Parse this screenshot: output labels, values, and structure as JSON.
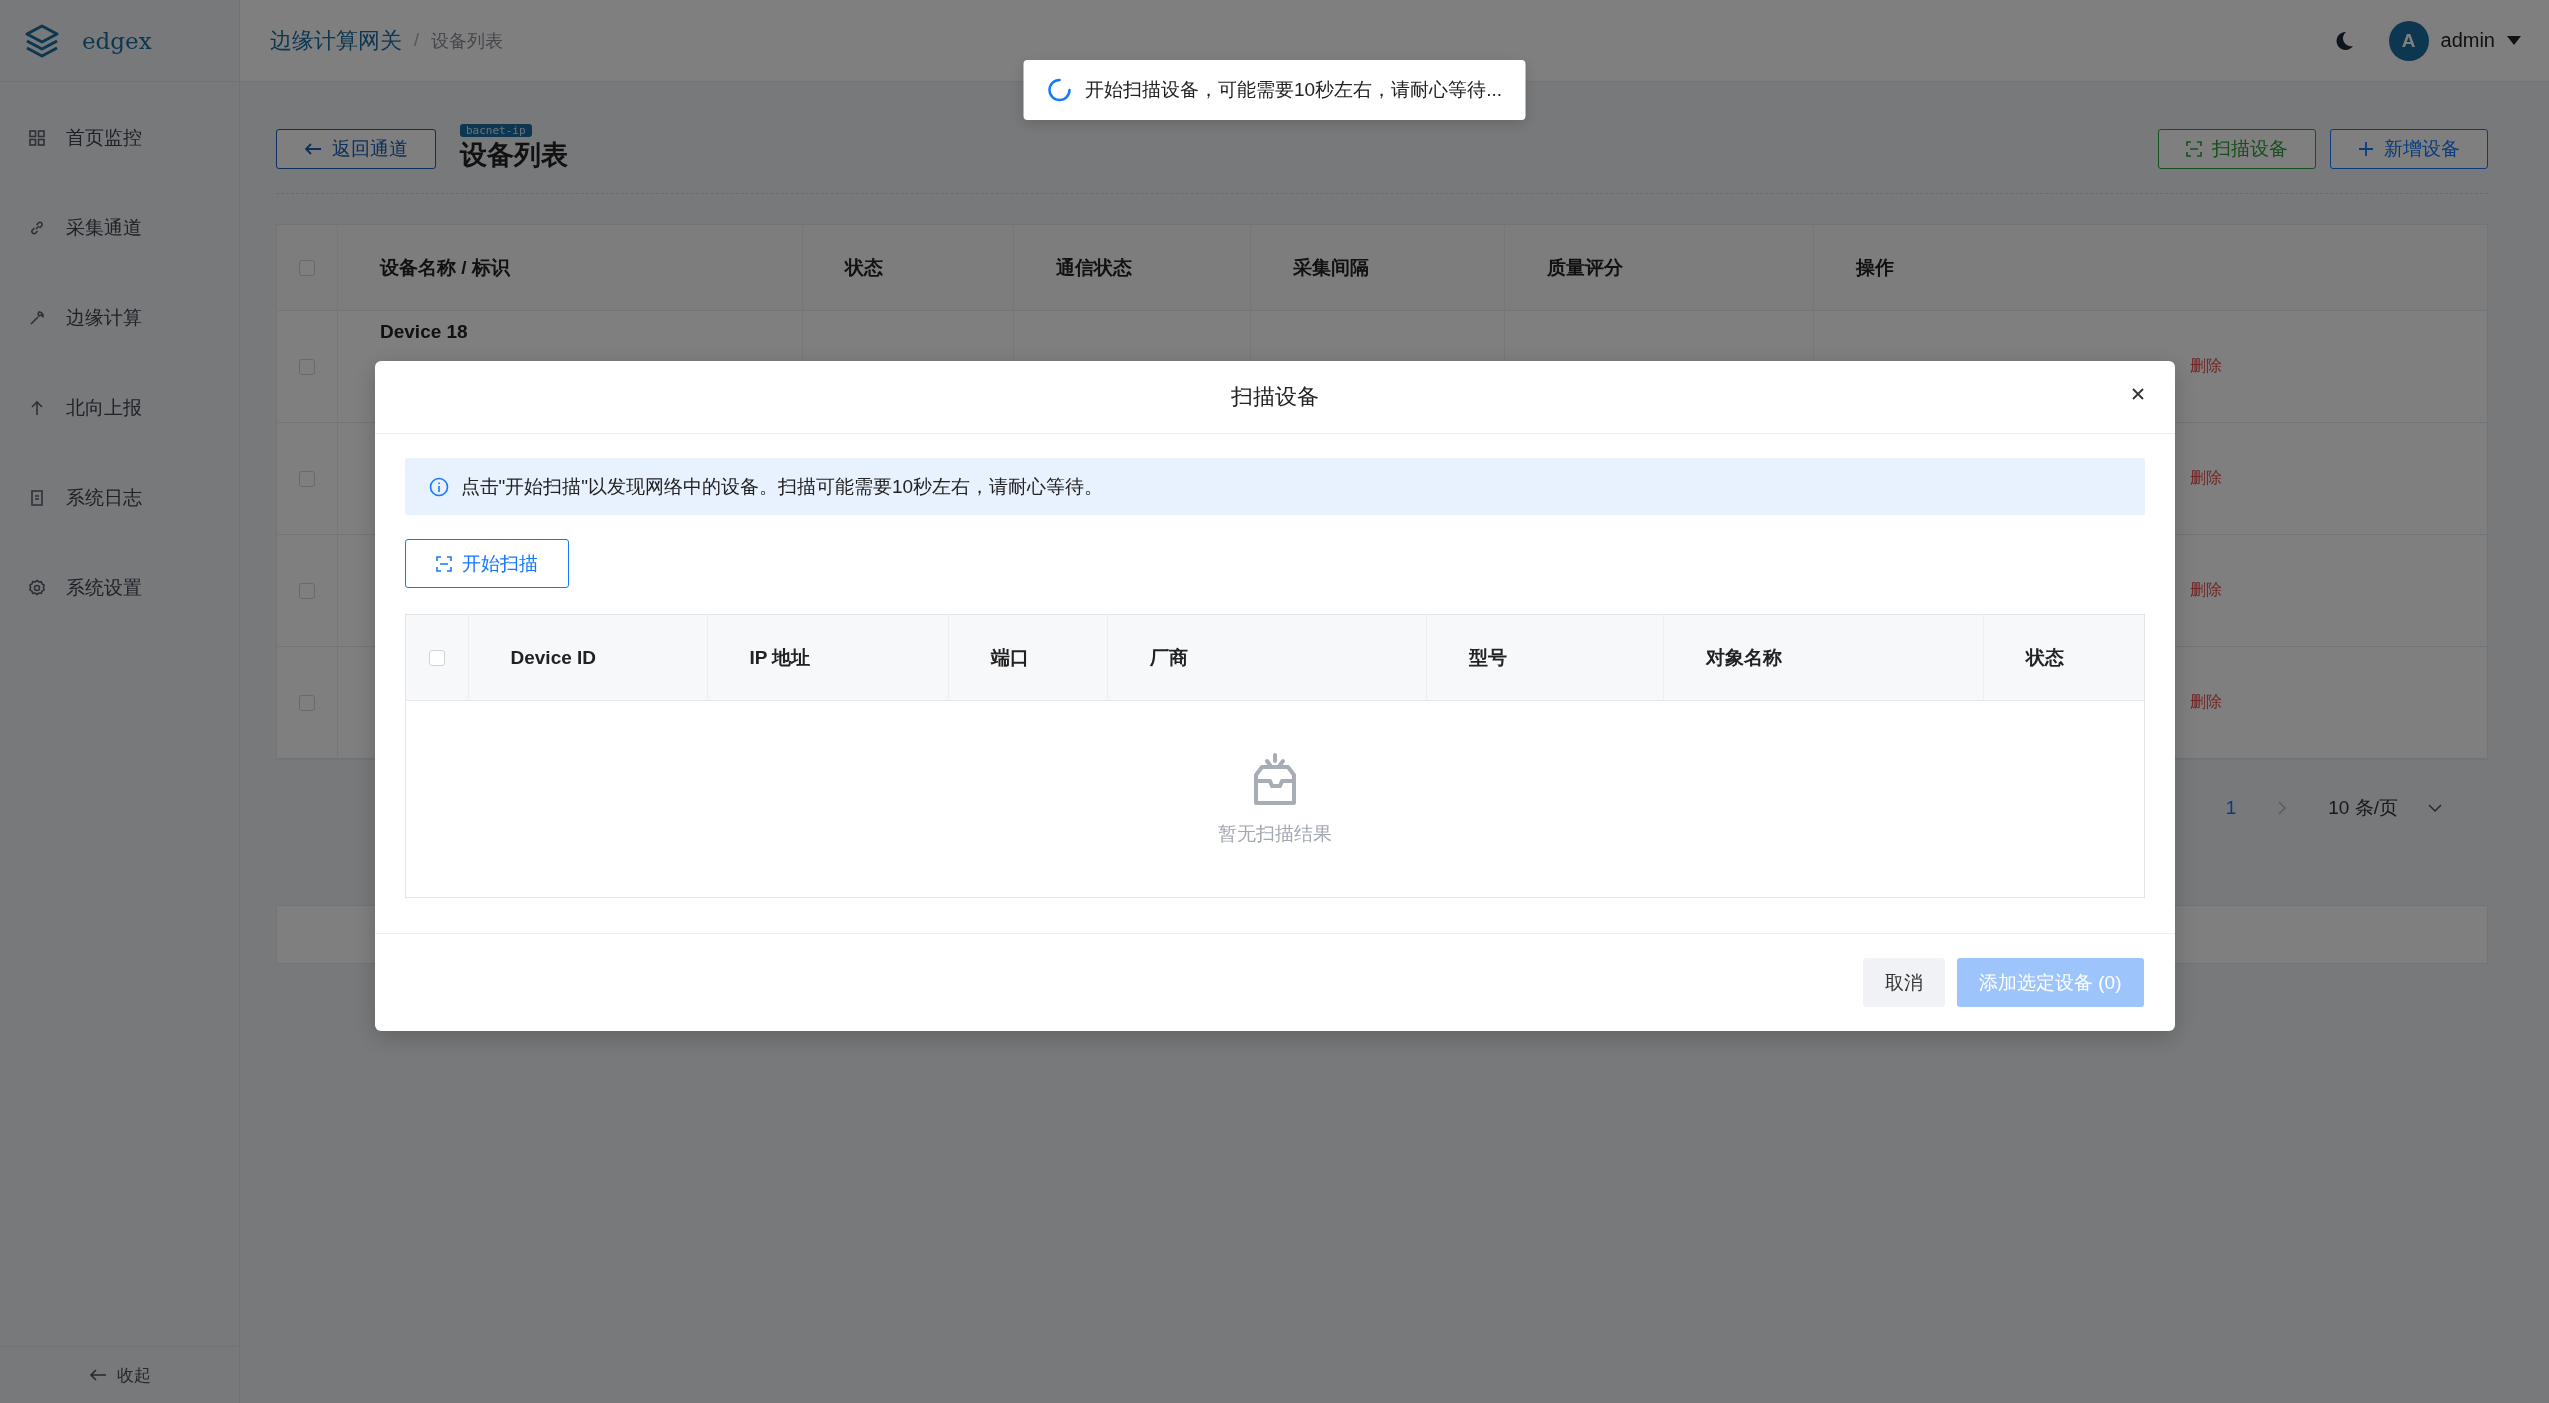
{
  "sidebar": {
    "logo": "edgex",
    "items": [
      {
        "label": "首页监控",
        "selected": false
      },
      {
        "label": "采集通道",
        "selected": false
      },
      {
        "label": "边缘计算",
        "selected": false
      },
      {
        "label": "北向上报",
        "selected": false
      },
      {
        "label": "系统日志",
        "selected": false
      },
      {
        "label": "系统设置",
        "selected": false
      }
    ],
    "collapse": "收起"
  },
  "header": {
    "breadcrumb": [
      "边缘计算网关",
      "设备列表"
    ],
    "breadcrumb_separator": "/",
    "avatar": "A",
    "user": "admin"
  },
  "page": {
    "back": "返回通道",
    "tag": "bacnet-ip",
    "title": "设备列表",
    "actions": [
      {
        "label": "扫描设备",
        "kind": "scan"
      },
      {
        "label": "新增设备",
        "kind": "add"
      }
    ]
  },
  "table": {
    "select_all_checked": false,
    "columns": [
      "设备名称 / 标识",
      "状态",
      "通信状态",
      "采集间隔",
      "质量评分",
      "操作"
    ],
    "rows": [
      {
        "checked": false,
        "name": "Device 18",
        "action": "删除"
      },
      {
        "checked": false,
        "action": "删除"
      },
      {
        "checked": false,
        "action": "删除"
      },
      {
        "checked": false,
        "action": "删除"
      }
    ]
  },
  "pagination": {
    "current": "1",
    "page_size": "10 条/页"
  },
  "toast": {
    "text": "开始扫描设备，可能需要10秒左右，请耐心等待..."
  },
  "modal": {
    "title": "扫描设备",
    "info": "点击\"开始扫描\"以发现网络中的设备。扫描可能需要10秒左右，请耐心等待。",
    "scan_button": "开始扫描",
    "select_all_checked": false,
    "columns": [
      "Device ID",
      "IP 地址",
      "端口",
      "厂商",
      "型号",
      "对象名称",
      "状态"
    ],
    "empty": "暂无扫描结果",
    "buttons": [
      {
        "label": "取消",
        "kind": "default",
        "disabled": false
      },
      {
        "label": "添加选定设备 (0)",
        "kind": "primary",
        "disabled": true
      }
    ]
  }
}
